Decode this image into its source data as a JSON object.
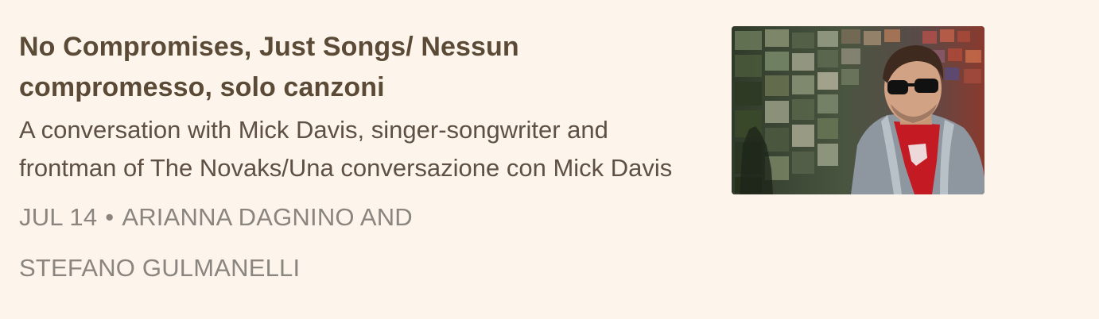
{
  "post": {
    "title": "No Compromises, Just Songs/ Nessun compromesso, solo canzoni",
    "subtitle": "A conversation with Mick Davis, singer-songwriter and frontman of The Novaks/Una conversazione con Mick Davis",
    "date": "JUL 14",
    "separator": "•",
    "authors": "ARIANNA DAGNINO AND STEFANO GULMANELLI",
    "thumbnail_icon": "man-with-sunglasses-photo"
  }
}
